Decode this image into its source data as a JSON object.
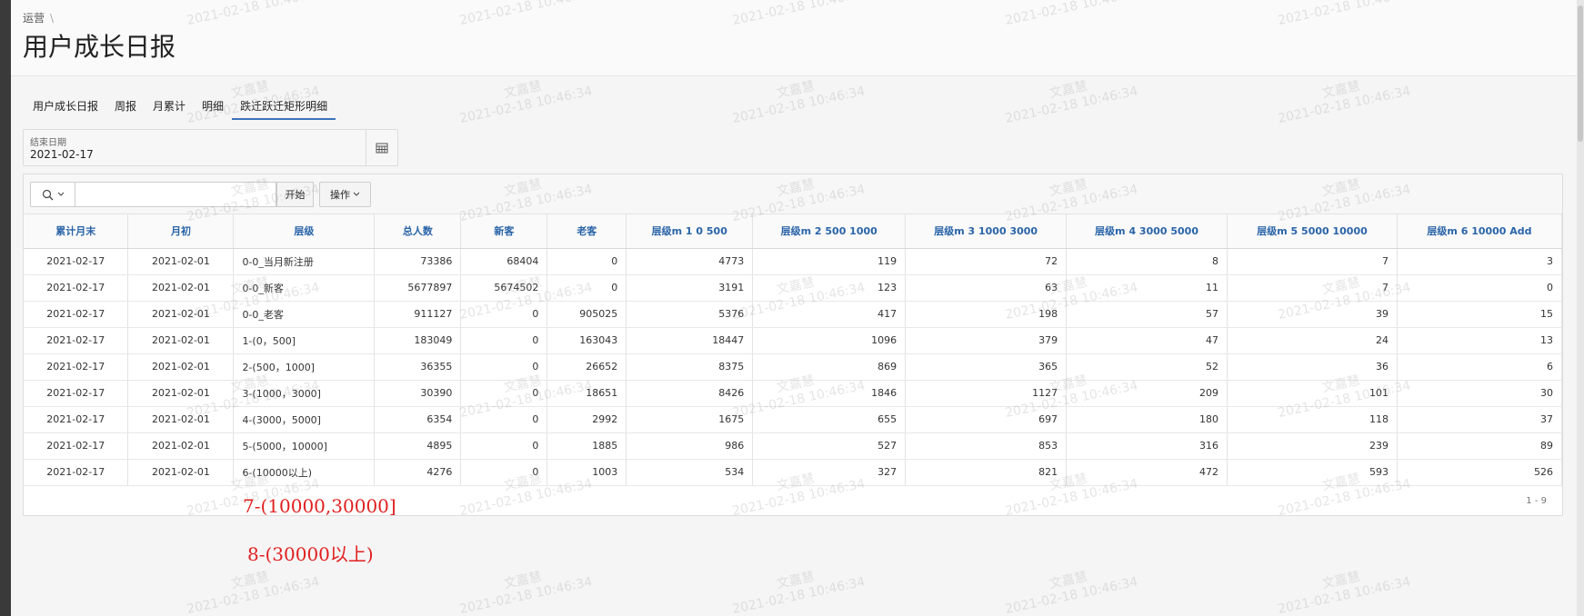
{
  "breadcrumb": {
    "item": "运营",
    "separator": "\\"
  },
  "page": {
    "title": "用户成长日报"
  },
  "tabs": [
    {
      "label": "用户成长日报",
      "active": false
    },
    {
      "label": "周报",
      "active": false
    },
    {
      "label": "月累计",
      "active": false
    },
    {
      "label": "明细",
      "active": false
    },
    {
      "label": "跌迁跃迁矩形明细",
      "active": true
    }
  ],
  "filter": {
    "end_date_label": "结束日期",
    "end_date_value": "2021-02-17",
    "calendar_icon": "calendar-icon"
  },
  "toolbar": {
    "search_value": "",
    "go_label": "开始",
    "actions_label": "操作",
    "search_icon": "search-icon"
  },
  "table": {
    "headers": [
      "累计月末",
      "月初",
      "层级",
      "总人数",
      "新客",
      "老客",
      "层级m 1 0 500",
      "层级m 2 500 1000",
      "层级m 3 1000 3000",
      "层级m 4 3000 5000",
      "层级m 5 5000 10000",
      "层级m 6 10000 Add"
    ],
    "rows": [
      [
        "2021-02-17",
        "2021-02-01",
        "0-0_当月新注册",
        "73386",
        "68404",
        "0",
        "4773",
        "119",
        "72",
        "8",
        "7",
        "3"
      ],
      [
        "2021-02-17",
        "2021-02-01",
        "0-0_新客",
        "5677897",
        "5674502",
        "0",
        "3191",
        "123",
        "63",
        "11",
        "7",
        "0"
      ],
      [
        "2021-02-17",
        "2021-02-01",
        "0-0_老客",
        "911127",
        "0",
        "905025",
        "5376",
        "417",
        "198",
        "57",
        "39",
        "15"
      ],
      [
        "2021-02-17",
        "2021-02-01",
        "1-(0，500]",
        "183049",
        "0",
        "163043",
        "18447",
        "1096",
        "379",
        "47",
        "24",
        "13"
      ],
      [
        "2021-02-17",
        "2021-02-01",
        "2-(500，1000]",
        "36355",
        "0",
        "26652",
        "8375",
        "869",
        "365",
        "52",
        "36",
        "6"
      ],
      [
        "2021-02-17",
        "2021-02-01",
        "3-(1000，3000]",
        "30390",
        "0",
        "18651",
        "8426",
        "1846",
        "1127",
        "209",
        "101",
        "30"
      ],
      [
        "2021-02-17",
        "2021-02-01",
        "4-(3000，5000]",
        "6354",
        "0",
        "2992",
        "1675",
        "655",
        "697",
        "180",
        "118",
        "37"
      ],
      [
        "2021-02-17",
        "2021-02-01",
        "5-(5000，10000]",
        "4895",
        "0",
        "1885",
        "986",
        "527",
        "853",
        "316",
        "239",
        "89"
      ],
      [
        "2021-02-17",
        "2021-02-01",
        "6-(10000以上)",
        "4276",
        "0",
        "1003",
        "534",
        "327",
        "821",
        "472",
        "593",
        "526"
      ]
    ],
    "pagination": "1 - 9"
  },
  "annotations": {
    "line1": "7-(10000,30000]",
    "line2": "8-(30000以上)"
  },
  "watermark": {
    "name": "文嘉慧",
    "timestamp": "2021-02-18 10:46:34"
  }
}
